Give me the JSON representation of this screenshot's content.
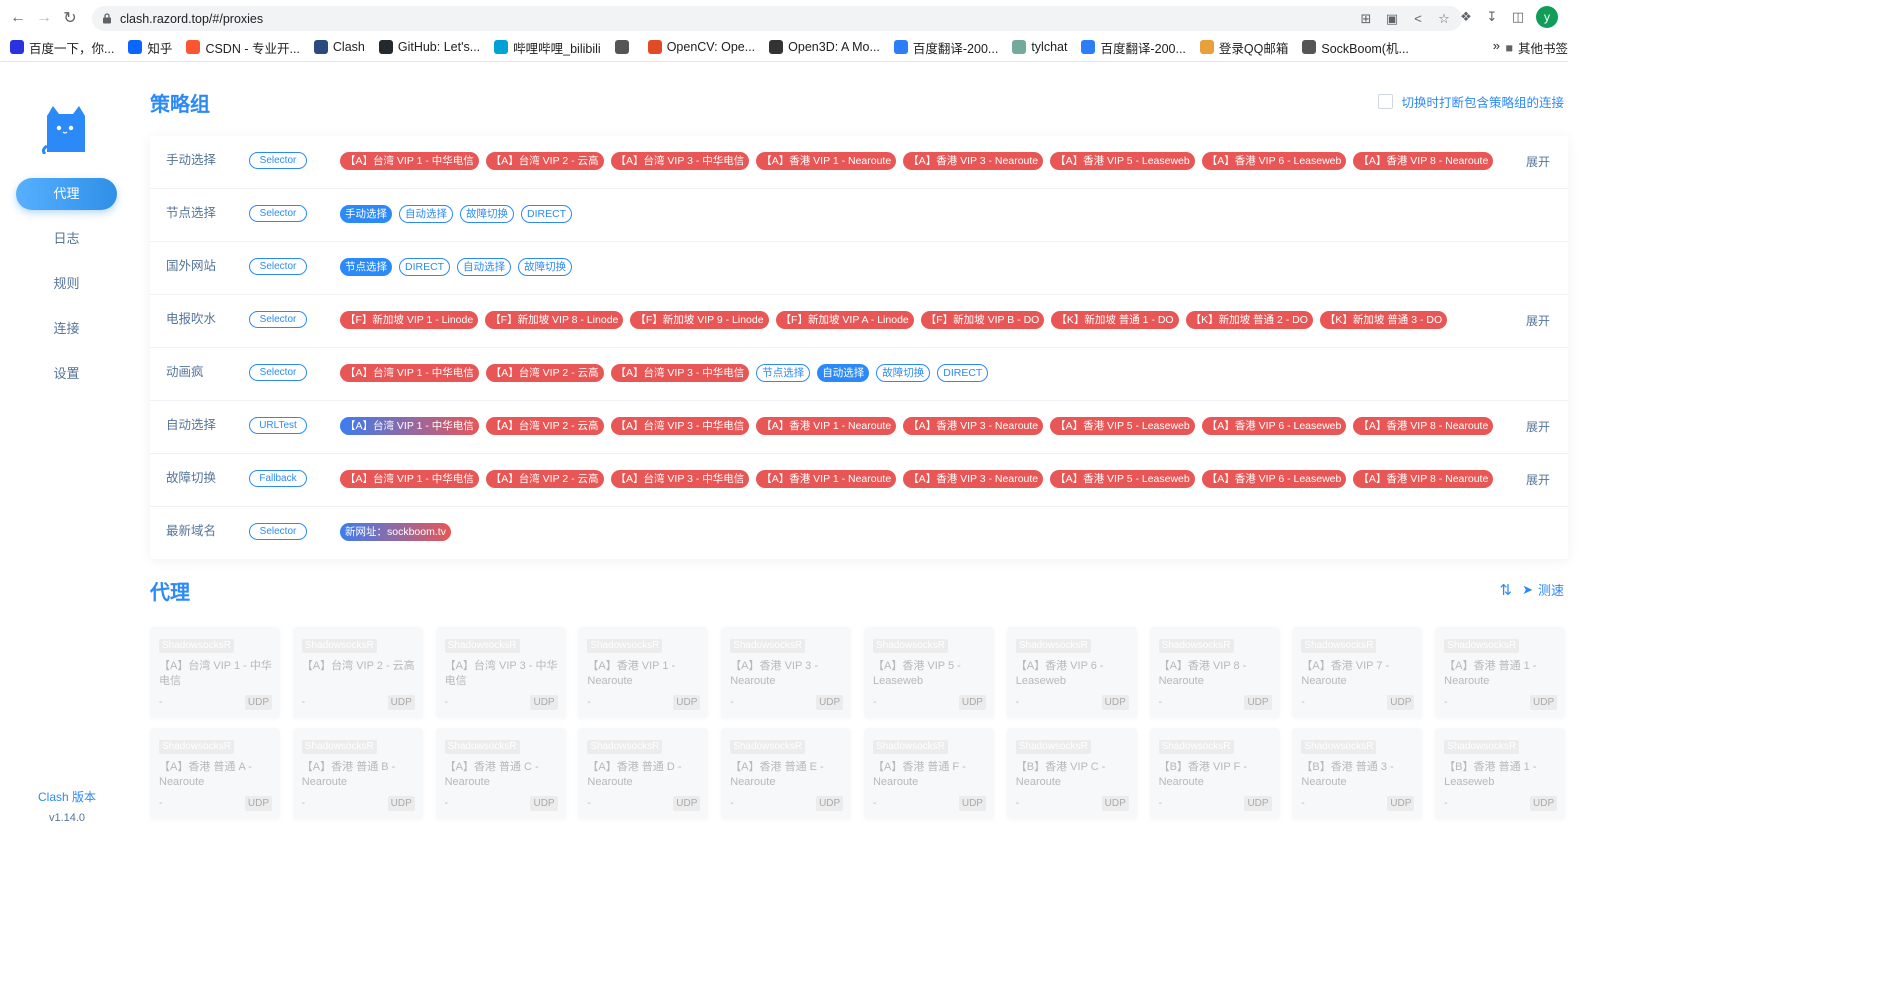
{
  "browser": {
    "url": "clash.razord.top/#/proxies",
    "avatar_letter": "y",
    "bookmarks": [
      {
        "label": "百度一下，你...",
        "color": "#2932e1",
        "icon": "paw-icon"
      },
      {
        "label": "知乎",
        "color": "#0a66ff",
        "icon": "zhihu-icon"
      },
      {
        "label": "CSDN - 专业开...",
        "color": "#fc5531",
        "icon": "csdn-icon"
      },
      {
        "label": "Clash",
        "color": "#2b4a7f",
        "icon": "cat-icon"
      },
      {
        "label": "GitHub: Let's...",
        "color": "#24292e",
        "icon": "github-icon"
      },
      {
        "label": "哔哩哔哩_bilibili",
        "color": "#00a1d6",
        "icon": "tv-icon"
      },
      {
        "label": "",
        "color": "#555",
        "icon": "globe-icon"
      },
      {
        "label": "OpenCV: Ope...",
        "color": "#e34b26",
        "icon": "opencv-icon"
      },
      {
        "label": "Open3D: A Mo...",
        "color": "#333",
        "icon": "open3d-icon"
      },
      {
        "label": "百度翻译-200...",
        "color": "#2c7ef8",
        "icon": "translate-icon"
      },
      {
        "label": "tylchat",
        "color": "#74aa9c",
        "icon": "chat-icon"
      },
      {
        "label": "百度翻译-200...",
        "color": "#2c7ef8",
        "icon": "translate-icon"
      },
      {
        "label": "登录QQ邮箱",
        "color": "#e8a13a",
        "icon": "qq-icon"
      },
      {
        "label": "SockBoom(机...",
        "color": "#555",
        "icon": "sock-icon"
      }
    ],
    "bookmarks_more": "»",
    "other_bookmarks": "其他书签"
  },
  "sidebar": {
    "menu": [
      "代理",
      "日志",
      "规则",
      "连接",
      "设置"
    ],
    "active_index": 0,
    "version_label": "Clash 版本",
    "version": "v1.14.0"
  },
  "groups_section": {
    "title": "策略组",
    "toggle_label": "切换时打断包含策略组的连接",
    "expand_label": "展开",
    "groups": [
      {
        "name": "手动选择",
        "type": "Selector",
        "expandable": true,
        "tags": [
          {
            "t": "【A】台湾 VIP 1 - 中华电信",
            "s": "red"
          },
          {
            "t": "【A】台湾 VIP 2 - 云高",
            "s": "red"
          },
          {
            "t": "【A】台湾 VIP 3 - 中华电信",
            "s": "red"
          },
          {
            "t": "【A】香港 VIP 1 - Nearoute",
            "s": "red"
          },
          {
            "t": "【A】香港 VIP 3 - Nearoute",
            "s": "red"
          },
          {
            "t": "【A】香港 VIP 5 - Leaseweb",
            "s": "red"
          },
          {
            "t": "【A】香港 VIP 6 - Leaseweb",
            "s": "red"
          },
          {
            "t": "【A】香港 VIP 8 - Nearoute",
            "s": "red"
          }
        ]
      },
      {
        "name": "节点选择",
        "type": "Selector",
        "expandable": false,
        "tags": [
          {
            "t": "手动选择",
            "s": "blue"
          },
          {
            "t": "自动选择",
            "s": "outline"
          },
          {
            "t": "故障切换",
            "s": "outline"
          },
          {
            "t": "DIRECT",
            "s": "outline"
          }
        ]
      },
      {
        "name": "国外网站",
        "type": "Selector",
        "expandable": false,
        "tags": [
          {
            "t": "节点选择",
            "s": "blue"
          },
          {
            "t": "DIRECT",
            "s": "outline"
          },
          {
            "t": "自动选择",
            "s": "outline"
          },
          {
            "t": "故障切换",
            "s": "outline"
          }
        ]
      },
      {
        "name": "电报吹水",
        "type": "Selector",
        "expandable": true,
        "tags": [
          {
            "t": "【F】新加坡 VIP 1 - Linode",
            "s": "red"
          },
          {
            "t": "【F】新加坡 VIP 8 - Linode",
            "s": "red"
          },
          {
            "t": "【F】新加坡 VIP 9 - Linode",
            "s": "red"
          },
          {
            "t": "【F】新加坡 VIP A - Linode",
            "s": "red"
          },
          {
            "t": "【F】新加坡 VIP B - DO",
            "s": "red"
          },
          {
            "t": "【K】新加坡 普通 1 - DO",
            "s": "red"
          },
          {
            "t": "【K】新加坡 普通 2 - DO",
            "s": "red"
          },
          {
            "t": "【K】新加坡 普通 3 - DO",
            "s": "red"
          }
        ]
      },
      {
        "name": "动画疯",
        "type": "Selector",
        "expandable": false,
        "tags": [
          {
            "t": "【A】台湾 VIP 1 - 中华电信",
            "s": "red"
          },
          {
            "t": "【A】台湾 VIP 2 - 云高",
            "s": "red"
          },
          {
            "t": "【A】台湾 VIP 3 - 中华电信",
            "s": "red"
          },
          {
            "t": "节点选择",
            "s": "outline"
          },
          {
            "t": "自动选择",
            "s": "blue"
          },
          {
            "t": "故障切换",
            "s": "outline"
          },
          {
            "t": "DIRECT",
            "s": "outline"
          }
        ]
      },
      {
        "name": "自动选择",
        "type": "URLTest",
        "expandable": true,
        "tags": [
          {
            "t": "【A】台湾 VIP 1 - 中华电信",
            "s": "grad"
          },
          {
            "t": "【A】台湾 VIP 2 - 云高",
            "s": "red"
          },
          {
            "t": "【A】台湾 VIP 3 - 中华电信",
            "s": "red"
          },
          {
            "t": "【A】香港 VIP 1 - Nearoute",
            "s": "red"
          },
          {
            "t": "【A】香港 VIP 3 - Nearoute",
            "s": "red"
          },
          {
            "t": "【A】香港 VIP 5 - Leaseweb",
            "s": "red"
          },
          {
            "t": "【A】香港 VIP 6 - Leaseweb",
            "s": "red"
          },
          {
            "t": "【A】香港 VIP 8 - Nearoute",
            "s": "red"
          }
        ]
      },
      {
        "name": "故障切换",
        "type": "Fallback",
        "expandable": true,
        "tags": [
          {
            "t": "【A】台湾 VIP 1 - 中华电信",
            "s": "red"
          },
          {
            "t": "【A】台湾 VIP 2 - 云高",
            "s": "red"
          },
          {
            "t": "【A】台湾 VIP 3 - 中华电信",
            "s": "red"
          },
          {
            "t": "【A】香港 VIP 1 - Nearoute",
            "s": "red"
          },
          {
            "t": "【A】香港 VIP 3 - Nearoute",
            "s": "red"
          },
          {
            "t": "【A】香港 VIP 5 - Leaseweb",
            "s": "red"
          },
          {
            "t": "【A】香港 VIP 6 - Leaseweb",
            "s": "red"
          },
          {
            "t": "【A】香港 VIP 8 - Nearoute",
            "s": "red"
          }
        ]
      },
      {
        "name": "最新域名",
        "type": "Selector",
        "expandable": false,
        "tags": [
          {
            "t": "新网址：sockboom.tv",
            "s": "grad"
          }
        ]
      }
    ]
  },
  "proxies_section": {
    "title": "代理",
    "speedtest_label": "测速",
    "cards": [
      {
        "type": "ShadowsocksR",
        "name": "【A】台湾 VIP 1 - 中华电信",
        "delay": "-",
        "udp": "UDP"
      },
      {
        "type": "ShadowsocksR",
        "name": "【A】台湾 VIP 2 - 云高",
        "delay": "-",
        "udp": "UDP"
      },
      {
        "type": "ShadowsocksR",
        "name": "【A】台湾 VIP 3 - 中华电信",
        "delay": "-",
        "udp": "UDP"
      },
      {
        "type": "ShadowsocksR",
        "name": "【A】香港 VIP 1 - Nearoute",
        "delay": "-",
        "udp": "UDP"
      },
      {
        "type": "ShadowsocksR",
        "name": "【A】香港 VIP 3 - Nearoute",
        "delay": "-",
        "udp": "UDP"
      },
      {
        "type": "ShadowsocksR",
        "name": "【A】香港 VIP 5 - Leaseweb",
        "delay": "-",
        "udp": "UDP"
      },
      {
        "type": "ShadowsocksR",
        "name": "【A】香港 VIP 6 - Leaseweb",
        "delay": "-",
        "udp": "UDP"
      },
      {
        "type": "ShadowsocksR",
        "name": "【A】香港 VIP 8 - Nearoute",
        "delay": "-",
        "udp": "UDP"
      },
      {
        "type": "ShadowsocksR",
        "name": "【A】香港 VIP 7 - Nearoute",
        "delay": "-",
        "udp": "UDP"
      },
      {
        "type": "ShadowsocksR",
        "name": "【A】香港 普通 1 - Nearoute",
        "delay": "-",
        "udp": "UDP"
      },
      {
        "type": "ShadowsocksR",
        "name": "【A】香港 普通 A - Nearoute",
        "delay": "-",
        "udp": "UDP"
      },
      {
        "type": "ShadowsocksR",
        "name": "【A】香港 普通 B - Nearoute",
        "delay": "-",
        "udp": "UDP"
      },
      {
        "type": "ShadowsocksR",
        "name": "【A】香港 普通 C - Nearoute",
        "delay": "-",
        "udp": "UDP"
      },
      {
        "type": "ShadowsocksR",
        "name": "【A】香港 普通 D - Nearoute",
        "delay": "-",
        "udp": "UDP"
      },
      {
        "type": "ShadowsocksR",
        "name": "【A】香港 普通 E - Nearoute",
        "delay": "-",
        "udp": "UDP"
      },
      {
        "type": "ShadowsocksR",
        "name": "【A】香港 普通 F - Nearoute",
        "delay": "-",
        "udp": "UDP"
      },
      {
        "type": "ShadowsocksR",
        "name": "【B】香港 VIP C - Nearoute",
        "delay": "-",
        "udp": "UDP"
      },
      {
        "type": "ShadowsocksR",
        "name": "【B】香港 VIP F - Nearoute",
        "delay": "-",
        "udp": "UDP"
      },
      {
        "type": "ShadowsocksR",
        "name": "【B】香港 普通 3 - Nearoute",
        "delay": "-",
        "udp": "UDP"
      },
      {
        "type": "ShadowsocksR",
        "name": "【B】香港 普通 1 - Leaseweb",
        "delay": "-",
        "udp": "UDP"
      }
    ]
  }
}
